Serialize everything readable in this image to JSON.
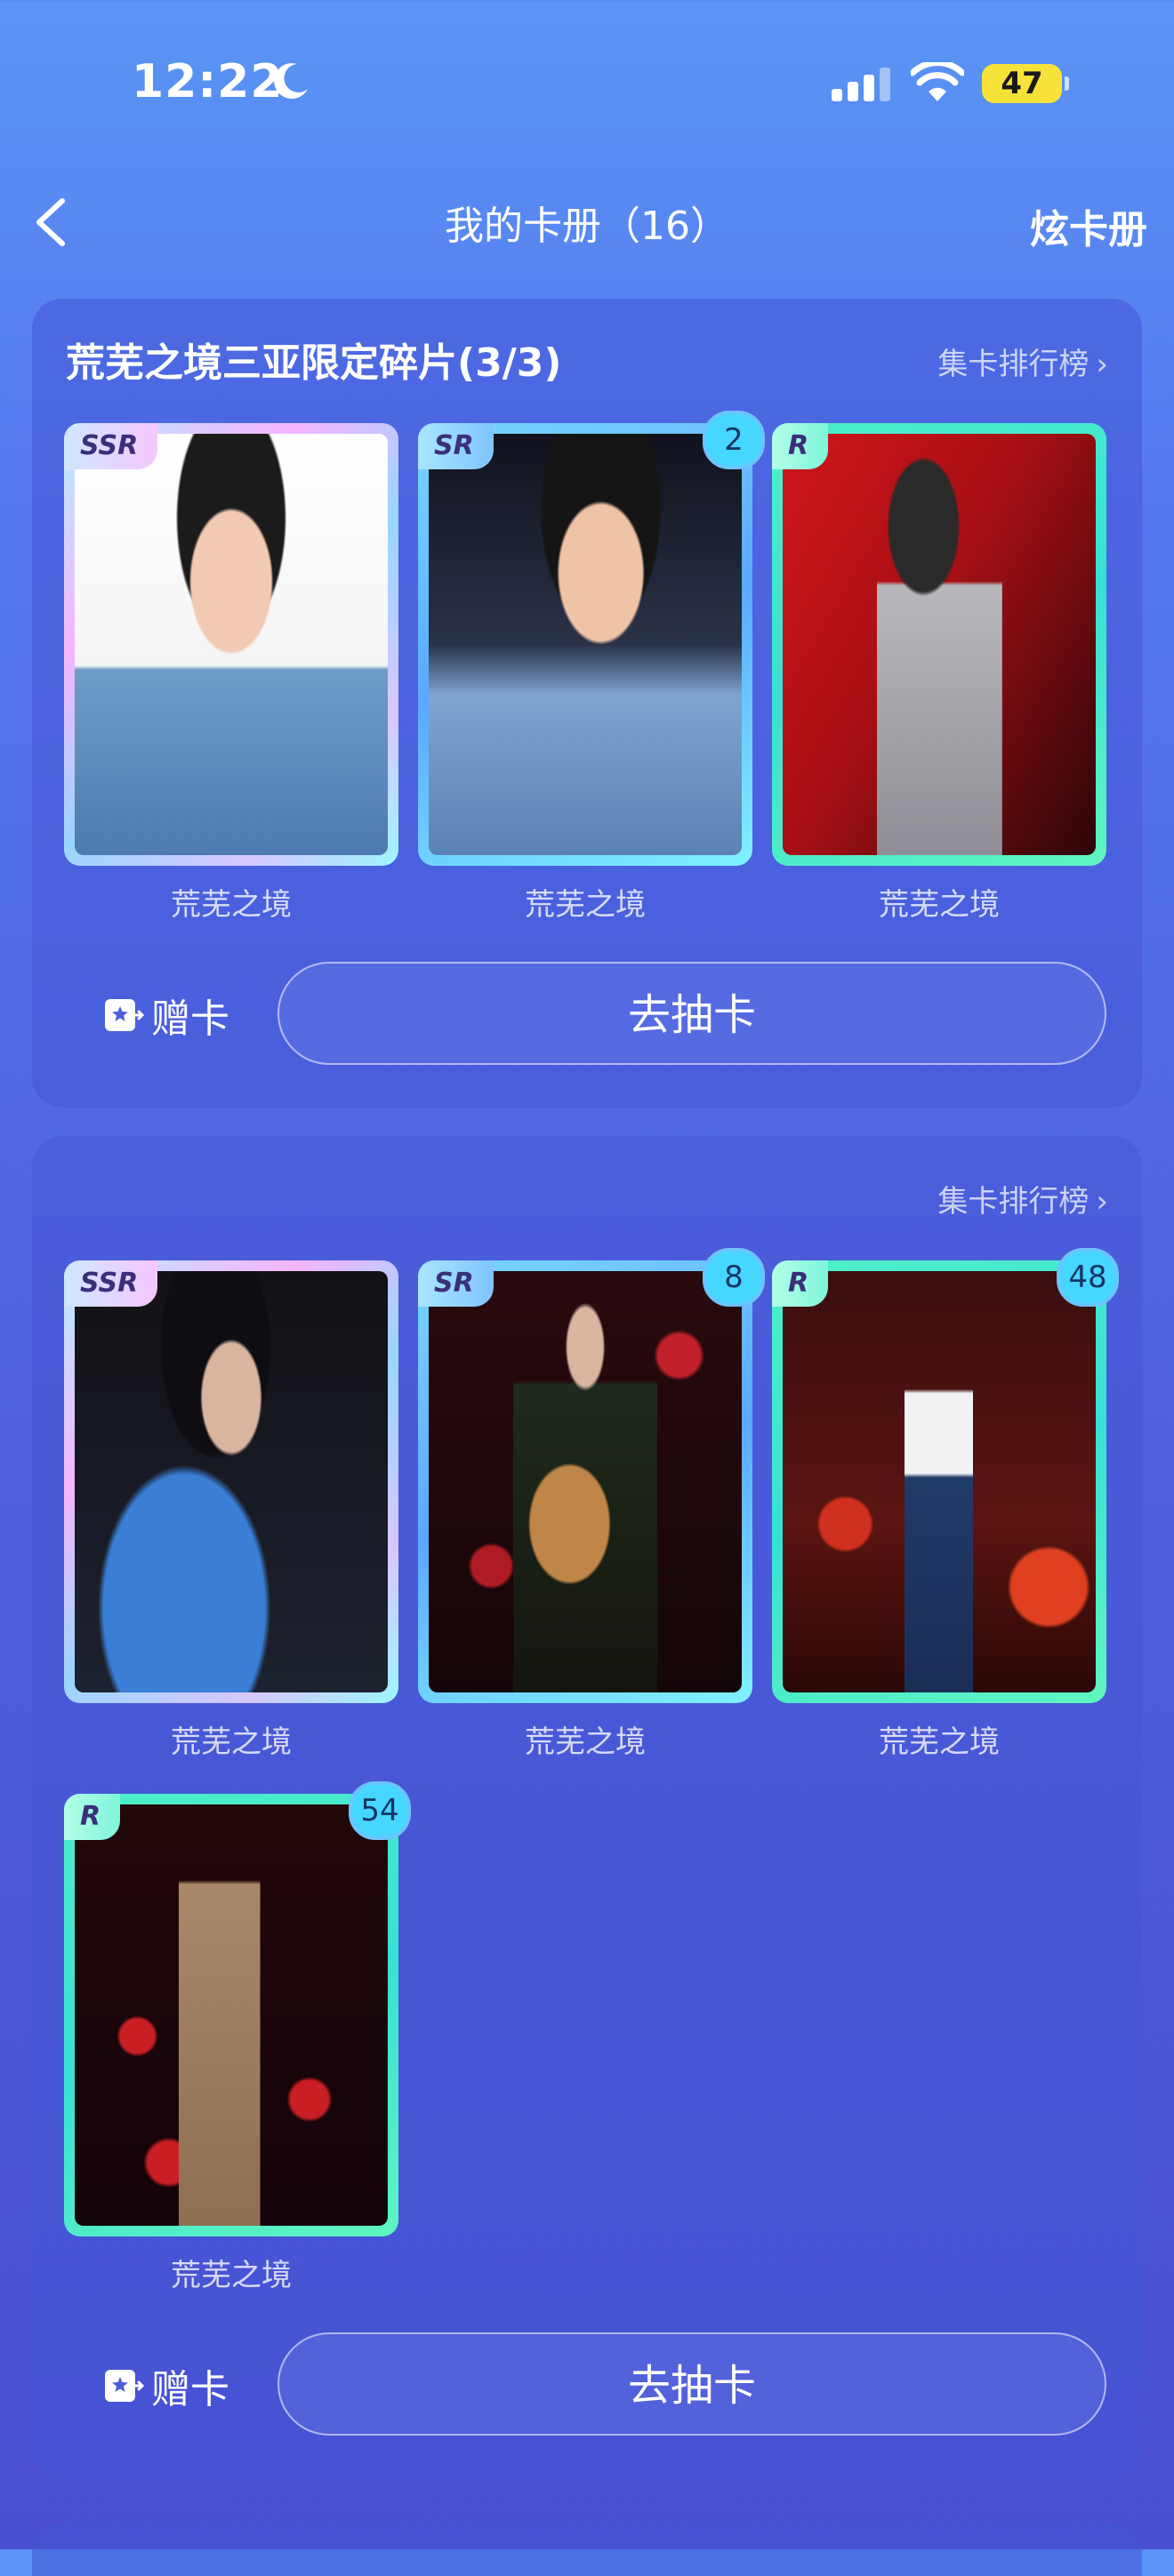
{
  "status": {
    "time": "12:22",
    "battery": "47"
  },
  "nav": {
    "title": "我的卡册（16）",
    "right": "炫卡册"
  },
  "panel1": {
    "title": "荒芜之境三亚限定碎片(3/3)",
    "rank": "集卡排行榜",
    "cards": [
      {
        "rarity": "SSR",
        "count": "",
        "caption": "荒芜之境"
      },
      {
        "rarity": "SR",
        "count": "2",
        "caption": "荒芜之境"
      },
      {
        "rarity": "R",
        "count": "",
        "caption": "荒芜之境"
      }
    ],
    "gift": "赠卡",
    "draw": "去抽卡"
  },
  "panel2": {
    "rank": "集卡排行榜",
    "cards": [
      {
        "rarity": "SSR",
        "count": "",
        "caption": "荒芜之境"
      },
      {
        "rarity": "SR",
        "count": "8",
        "caption": "荒芜之境"
      },
      {
        "rarity": "R",
        "count": "48",
        "caption": "荒芜之境"
      },
      {
        "rarity": "R",
        "count": "54",
        "caption": "荒芜之境"
      }
    ],
    "gift": "赠卡",
    "draw": "去抽卡"
  }
}
